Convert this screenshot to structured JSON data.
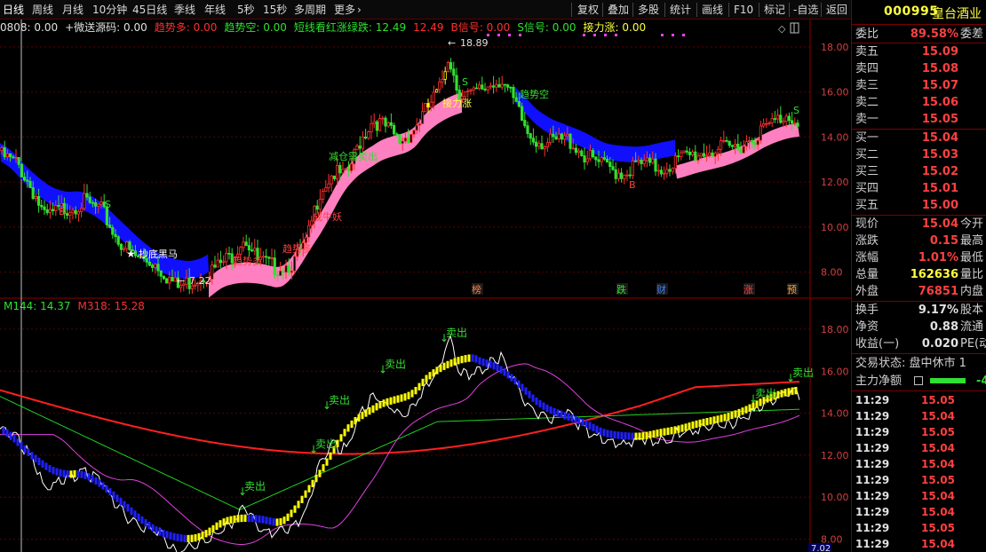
{
  "toolbar": {
    "periods": [
      "日线",
      "周线",
      "月线",
      "10分钟",
      "45日线",
      "季线",
      "年线",
      "5秒",
      "15秒",
      "多周期",
      "更多"
    ],
    "more_arrow": "›",
    "actions": [
      "复权",
      "叠加",
      "多股",
      "统计",
      "画线",
      "F10",
      "标记",
      "-自选",
      "返回"
    ]
  },
  "upper_header": {
    "segments": [
      {
        "text": "0808: 0.00",
        "color": "#e0e0e0"
      },
      {
        "text": "+微送源码: 0.00",
        "color": "#e0e0e0"
      },
      {
        "text": "趋势多: 0.00",
        "color": "#ff3030"
      },
      {
        "text": "趋势空: 0.00",
        "color": "#30e030"
      },
      {
        "text": "短线看红涨绿跌: 12.49",
        "color": "#30e030"
      },
      {
        "text": "12.49",
        "color": "#ff3030"
      },
      {
        "text": "B信号: 0.00",
        "color": "#ff3030"
      },
      {
        "text": "S信号: 0.00",
        "color": "#30e030"
      },
      {
        "text": "接力涨: 0.00",
        "color": "#ffff40"
      }
    ]
  },
  "lower_header": {
    "segments": [
      {
        "text": "M144: 14.37",
        "color": "#30e030"
      },
      {
        "text": "M318: 15.28",
        "color": "#ff3030"
      }
    ]
  },
  "upper_axis": [
    "18.00",
    "16.00",
    "14.00",
    "12.00",
    "10.00",
    "8.00"
  ],
  "lower_axis": [
    "18.00",
    "16.00",
    "14.00",
    "12.00",
    "10.00",
    "8.00"
  ],
  "upper_annotations": {
    "high": "18.89",
    "low": "7.22",
    "dark_horse": "抄底黑马",
    "trend_long_1": "趋势多",
    "trend_long_2": "趋势多",
    "trend_short": "趋势空",
    "relay": "接力涨",
    "reduce": "减仓需卖出",
    "monster": "成牛妖",
    "b_marker": "B",
    "s_marker": "S",
    "s_signal": "S信号"
  },
  "event_markers": [
    {
      "text": "榜",
      "color": "#ff8040"
    },
    {
      "text": "跌",
      "color": "#30e030"
    },
    {
      "text": "财",
      "color": "#4080ff"
    },
    {
      "text": "涨",
      "color": "#ff4040"
    },
    {
      "text": "预",
      "color": "#ffa040"
    }
  ],
  "lower_annotations": {
    "sell": "卖出"
  },
  "bottom_price": "7.02",
  "panel": {
    "code": "000995",
    "name": "皇台酒业",
    "weibi": {
      "label": "委比",
      "value": "89.58%",
      "extra": "委差"
    },
    "asks": [
      {
        "label": "卖五",
        "price": "15.09"
      },
      {
        "label": "卖四",
        "price": "15.08"
      },
      {
        "label": "卖三",
        "price": "15.07"
      },
      {
        "label": "卖二",
        "price": "15.06"
      },
      {
        "label": "卖一",
        "price": "15.05"
      }
    ],
    "bids": [
      {
        "label": "买一",
        "price": "15.04"
      },
      {
        "label": "买二",
        "price": "15.03"
      },
      {
        "label": "买三",
        "price": "15.02"
      },
      {
        "label": "买四",
        "price": "15.01"
      },
      {
        "label": "买五",
        "price": "15.00"
      }
    ],
    "quote": [
      {
        "label": "现价",
        "value": "15.04",
        "extra": "今开",
        "color": "#ff4040"
      },
      {
        "label": "涨跌",
        "value": "0.15",
        "extra": "最高",
        "color": "#ff4040"
      },
      {
        "label": "涨幅",
        "value": "1.01%",
        "extra": "最低",
        "color": "#ff4040"
      },
      {
        "label": "总量",
        "value": "162636",
        "extra": "量比",
        "color": "#ffff40"
      },
      {
        "label": "外盘",
        "value": "76851",
        "extra": "内盘",
        "color": "#ff4040"
      }
    ],
    "stats": [
      {
        "label": "换手",
        "value": "9.17%",
        "extra": "股本",
        "color": "#e0e0e0"
      },
      {
        "label": "净资",
        "value": "0.88",
        "extra": "流通",
        "color": "#e0e0e0"
      },
      {
        "label": "收益(一)",
        "value": "0.020",
        "extra": "PE(动",
        "color": "#e0e0e0"
      }
    ],
    "trade_status": "交易状态: 盘中休市 1",
    "main_net": "主力净额",
    "main_net_value": "-4",
    "ticks": [
      {
        "time": "11:29",
        "price": "15.05"
      },
      {
        "time": "11:29",
        "price": "15.04"
      },
      {
        "time": "11:29",
        "price": "15.05"
      },
      {
        "time": "11:29",
        "price": "15.04"
      },
      {
        "time": "11:29",
        "price": "15.04"
      },
      {
        "time": "11:29",
        "price": "15.05"
      },
      {
        "time": "11:29",
        "price": "15.04"
      },
      {
        "time": "11:29",
        "price": "15.04"
      },
      {
        "time": "11:29",
        "price": "15.05"
      },
      {
        "time": "11:29",
        "price": "15.04"
      }
    ]
  },
  "colors": {
    "up": "#ff3030",
    "down": "#30e030",
    "blue_band": "#1010ff",
    "pink_band": "#ff80c0",
    "yellow": "#ffff00",
    "grid": "#600000"
  }
}
